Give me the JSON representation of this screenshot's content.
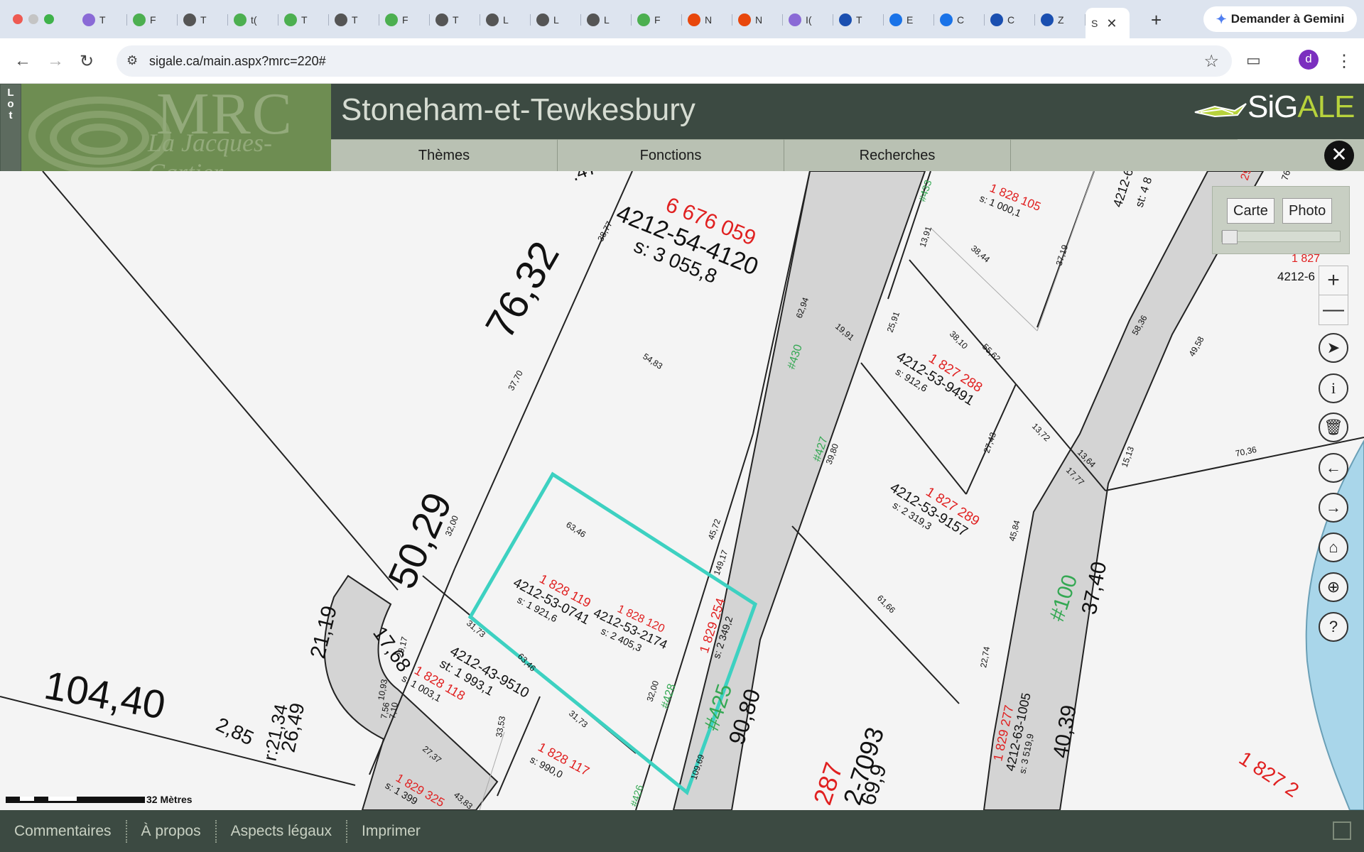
{
  "browser": {
    "tabs": [
      {
        "label": "T",
        "color": "#8a6ad6"
      },
      {
        "label": "F",
        "color": "#4caf50"
      },
      {
        "label": "T",
        "color": "#555555"
      },
      {
        "label": "t(",
        "color": "#4caf50"
      },
      {
        "label": "T",
        "color": "#4caf50"
      },
      {
        "label": "T",
        "color": "#555555"
      },
      {
        "label": "F",
        "color": "#4caf50"
      },
      {
        "label": "T",
        "color": "#555555"
      },
      {
        "label": "L",
        "color": "#555555"
      },
      {
        "label": "L",
        "color": "#555555"
      },
      {
        "label": "L",
        "color": "#555555"
      },
      {
        "label": "F",
        "color": "#4caf50"
      },
      {
        "label": "N",
        "color": "#e8470c"
      },
      {
        "label": "N",
        "color": "#e8470c"
      },
      {
        "label": "I(",
        "color": "#8a6ad6"
      },
      {
        "label": "T",
        "color": "#1a4fb0"
      },
      {
        "label": "E",
        "color": "#1a73e8"
      },
      {
        "label": "C",
        "color": "#1a73e8"
      },
      {
        "label": "C",
        "color": "#1a4fb0"
      },
      {
        "label": "Z",
        "color": "#1a4fb0"
      }
    ],
    "active_tab": {
      "label": "S",
      "close": "✕"
    },
    "new_tab": "+",
    "gemini_label": "Demander à Gemini",
    "url": "sigale.ca/main.aspx?mrc=220#",
    "avatar_initial": "d"
  },
  "app": {
    "side_tab": [
      "L",
      "o",
      "t"
    ],
    "logo_mrc": "MRC",
    "logo_sub": "La Jacques-Cartier",
    "title": "Stoneham-et-Tewkesbury",
    "brand": {
      "si": "SiG",
      "ale": "ALE"
    },
    "menu": [
      "Thèmes",
      "Fonctions",
      "Recherches",
      ""
    ],
    "close": "✕"
  },
  "map": {
    "layers": {
      "carte": "Carte",
      "photo": "Photo"
    },
    "zoom_in": "+",
    "zoom_out": "—",
    "scale_label": "32 Mètres",
    "selected_lot": {
      "lot": "1 828 120",
      "matricule": "4212-53-2174",
      "area": "s: 2 405,3"
    },
    "lots": [
      {
        "lot": "6 676 059",
        "matricule": "4212-54-4120",
        "area": "s: 3 055,8"
      },
      {
        "lot": "1 828 119",
        "matricule": "4212-53-0741",
        "area": "s: 1 921,6"
      },
      {
        "lot": "1 828 118",
        "matricule": "4212-43-9510",
        "area": "s: 1 003,1",
        "extra": "st: 1 993,1"
      },
      {
        "lot": "1 828 117",
        "area": "s: 990,0"
      },
      {
        "lot": "1 829 254",
        "area": "s: 2 349,2"
      },
      {
        "lot": "1 827 288",
        "matricule": "4212-53-9491",
        "area": "s: 912,6"
      },
      {
        "lot": "1 827 289",
        "matricule": "4212-53-9157",
        "area": "s: 2 319,3"
      },
      {
        "lot": "1 828 105",
        "area": "s: 1 000,1"
      },
      {
        "lot": "1 829 277",
        "matricule": "4212-63-1005",
        "area": "s: 3 519,9"
      },
      {
        "lot": "1 829 325",
        "area": "s: 1 399"
      }
    ],
    "dimensions_big": [
      "76,32",
      "50,29",
      "104,40",
      "21,19",
      "17,68",
      "2,85",
      "26,49",
      "r:21,34",
      "90,80",
      "37,40",
      "40,39"
    ],
    "dimensions_small": [
      "54,83",
      "37,70",
      "63,46",
      "45,72",
      "32,00",
      "38,77",
      "62,94",
      "19,91",
      "25,91",
      "13,91",
      "38,44",
      "37,19",
      "38,10",
      "55,62",
      "58,36",
      "49,58",
      "27,43",
      "13,72",
      "13,64",
      "17,77",
      "15,13",
      "70,36",
      "45,84",
      "22,74",
      "61,66",
      "39,80",
      "149,17",
      "31,73",
      "63,46",
      "31,73",
      "33,53",
      "27,37",
      "43,83",
      "29,17",
      "10,93",
      "7,56",
      "7,10",
      "109,69",
      "32,00"
    ],
    "street_labels": [
      "#433",
      "#430",
      "#427",
      "#428",
      "#425",
      "#100",
      "#426"
    ],
    "partial_labels": [
      ".47",
      "287",
      "2-7093",
      "69,9",
      "4212-6",
      "st: 4 8",
      "1 827",
      "4212-6",
      "1 827 2",
      "29",
      "76"
    ]
  },
  "footer": {
    "links": [
      "Commentaires",
      "À propos",
      "Aspects légaux",
      "Imprimer"
    ]
  }
}
